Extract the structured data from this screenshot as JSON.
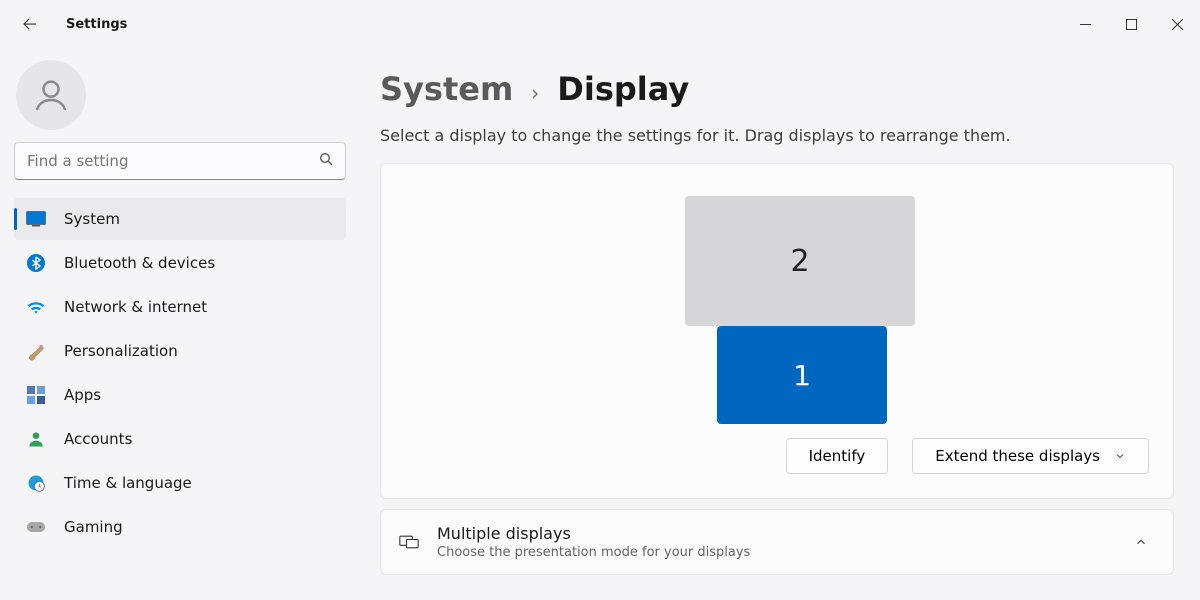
{
  "app_title": "Settings",
  "search": {
    "placeholder": "Find a setting"
  },
  "sidebar": {
    "items": [
      {
        "label": "System"
      },
      {
        "label": "Bluetooth & devices"
      },
      {
        "label": "Network & internet"
      },
      {
        "label": "Personalization"
      },
      {
        "label": "Apps"
      },
      {
        "label": "Accounts"
      },
      {
        "label": "Time & language"
      },
      {
        "label": "Gaming"
      }
    ]
  },
  "breadcrumb": {
    "parent": "System",
    "current": "Display"
  },
  "main": {
    "subtext": "Select a display to change the settings for it. Drag displays to rearrange them.",
    "monitors": {
      "m1": "1",
      "m2": "2"
    },
    "identify_label": "Identify",
    "extend_label": "Extend these displays",
    "multi": {
      "title": "Multiple displays",
      "sub": "Choose the presentation mode for your displays"
    }
  }
}
